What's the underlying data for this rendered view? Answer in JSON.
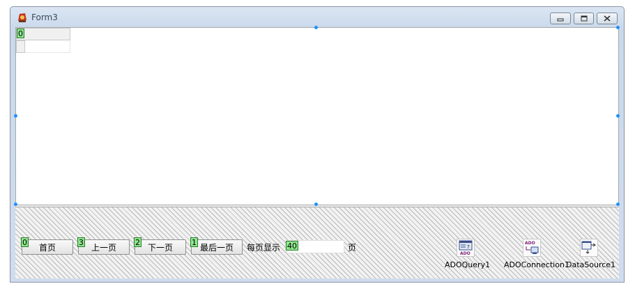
{
  "window": {
    "title": "Form3"
  },
  "grid": {
    "fixed_tag": "0"
  },
  "panel": {
    "buttons": [
      {
        "label": "首页",
        "tag": "0"
      },
      {
        "label": "上一页",
        "tag": "3"
      },
      {
        "label": "下一页",
        "tag": "2"
      },
      {
        "label": "最后一页",
        "tag": "1"
      }
    ],
    "per_page_label": "每页显示",
    "per_page_value": "40",
    "page_unit": "页"
  },
  "components": [
    {
      "name": "ADOQuery1",
      "icon": "adoquery-icon"
    },
    {
      "name": "ADOConnection1",
      "icon": "adoconnection-icon"
    },
    {
      "name": "DataSource1",
      "icon": "datasource-icon"
    }
  ],
  "colors": {
    "title_bar": "#c9d9ec",
    "selection_handle": "#1e90ff",
    "tag_background": "#8ee68e"
  }
}
